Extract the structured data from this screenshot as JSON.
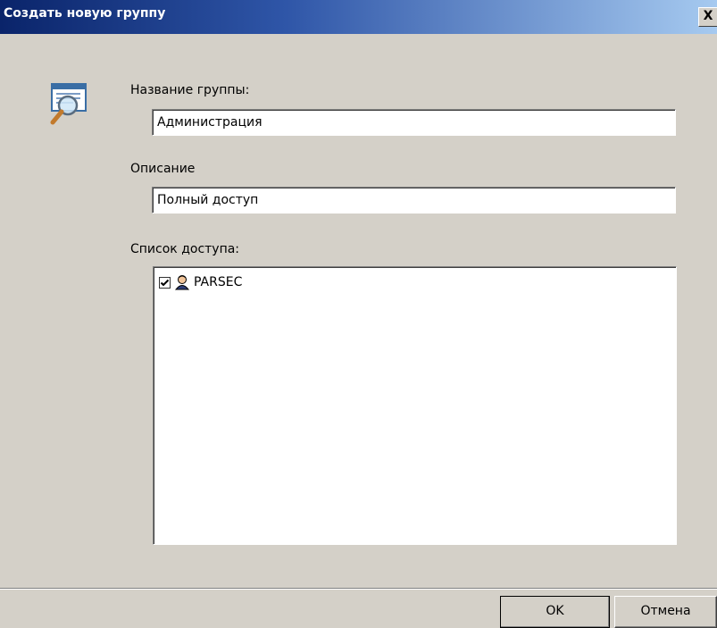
{
  "window": {
    "title": "Создать новую группу",
    "close_glyph": "X",
    "icon": "group-properties-icon",
    "title_bar_color": "#0a246a"
  },
  "form": {
    "group_name": {
      "label": "Название группы:",
      "value": "Администрация"
    },
    "description": {
      "label": "Описание",
      "value": "Полный доступ"
    },
    "access_list": {
      "label": "Список доступа:",
      "items": [
        {
          "label": "PARSEC",
          "checked": true,
          "icon": "user-icon"
        }
      ]
    }
  },
  "buttons": {
    "ok": "OK",
    "cancel": "Отмена"
  }
}
